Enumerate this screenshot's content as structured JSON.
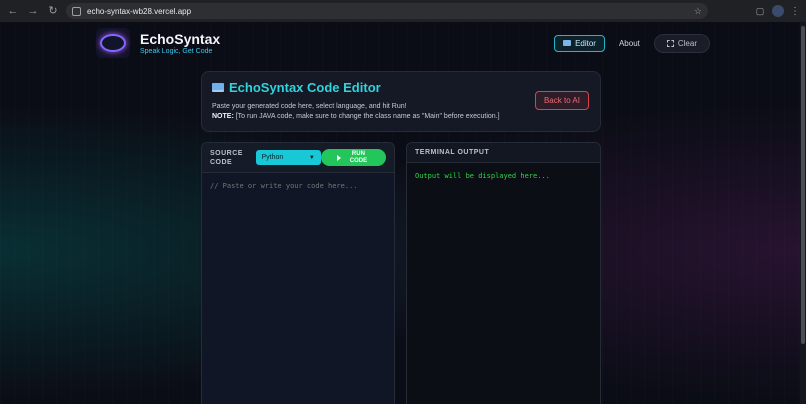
{
  "browser": {
    "url": "echo-syntax-wb28.vercel.app"
  },
  "header": {
    "brand_title": "EchoSyntax",
    "brand_tagline": "Speak Logic, Get Code",
    "nav_editor": "Editor",
    "nav_about": "About",
    "nav_clear": "Clear"
  },
  "intro": {
    "title": "EchoSyntax Code Editor",
    "description": "Paste your generated code here, select language, and hit Run!",
    "note_label": "NOTE:",
    "note_text": " [To run JAVA code, make sure to change the class name as \"Main\" before execution.]",
    "back_button": "Back to AI"
  },
  "source_panel": {
    "label": "SOURCE CODE",
    "language_selected": "Python",
    "run_label": "RUN CODE",
    "placeholder": "// Paste or write your code here..."
  },
  "terminal_panel": {
    "label": "TERMINAL OUTPUT",
    "output": "Output will be displayed here..."
  },
  "colors": {
    "accent_cyan": "#2fd4dc",
    "run_green": "#23c65a",
    "back_red": "#f06a70",
    "terminal_green": "#33d44a"
  }
}
